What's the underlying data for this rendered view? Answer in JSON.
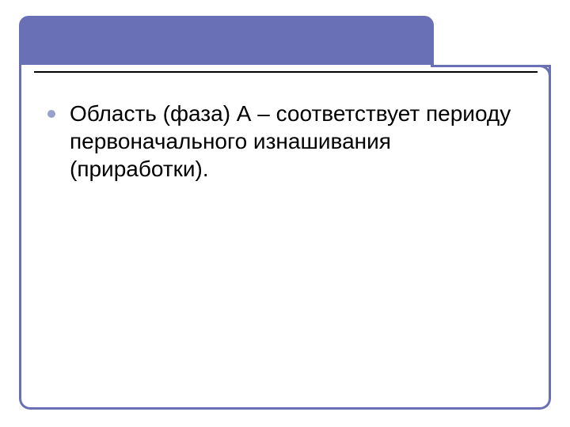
{
  "slide": {
    "bullets": [
      {
        "text": "Область (фаза) А – соответствует периоду первоначального изнашивания (приработки)."
      }
    ]
  },
  "colors": {
    "accent": "#6a70b6",
    "bullet": "#9aa0c9"
  }
}
